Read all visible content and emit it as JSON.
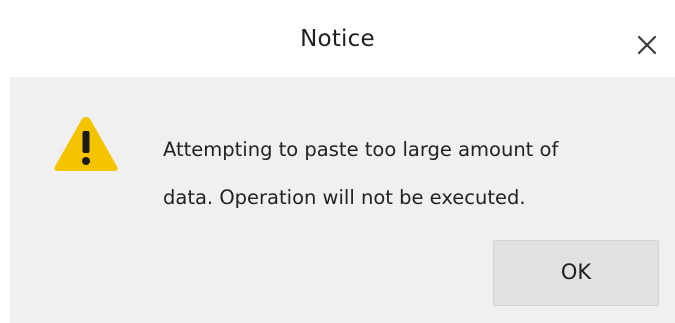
{
  "dialog": {
    "title": "Notice",
    "message_line1": "Attempting to paste too large amount of",
    "message_line2": "data. Operation will not be executed.",
    "ok_label": "OK",
    "icons": {
      "close": "close-icon",
      "warning": "warning-icon"
    },
    "colors": {
      "warning_fill": "#f5c400",
      "warning_mark": "#1a1a1a",
      "body_background": "#f0f0f0",
      "button_background": "#e1e1e1"
    }
  }
}
